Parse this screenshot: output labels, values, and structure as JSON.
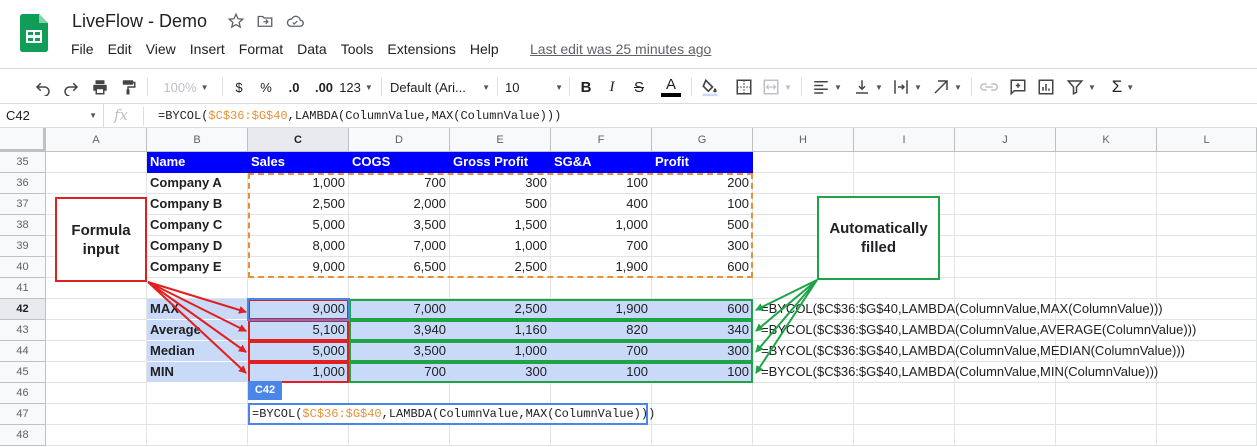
{
  "app": {
    "title": "LiveFlow - Demo",
    "last_edit": "Last edit was 25 minutes ago",
    "menu": [
      "File",
      "Edit",
      "View",
      "Insert",
      "Format",
      "Data",
      "Tools",
      "Extensions",
      "Help"
    ]
  },
  "toolbar": {
    "zoom": "100%",
    "currency": "$",
    "percent": "%",
    "decimal_decrease": ".0",
    "decimal_increase": ".00",
    "number_format": "123",
    "font": "Default (Ari...",
    "font_size": "10",
    "bold": "B",
    "italic": "I",
    "strikethrough": "S",
    "text_color": "A",
    "sum": "Σ"
  },
  "formula_bar": {
    "name_box": "C42",
    "fx": "fx",
    "formula_prefix": "=BYCOL(",
    "formula_ref": "$C$36:$G$40",
    "formula_suffix": ",LAMBDA(ColumnValue,MAX(ColumnValue)))"
  },
  "columns": [
    "A",
    "B",
    "C",
    "D",
    "E",
    "F",
    "G",
    "H",
    "I",
    "J",
    "K",
    "L"
  ],
  "rows": [
    "35",
    "36",
    "37",
    "38",
    "39",
    "40",
    "41",
    "42",
    "43",
    "44",
    "45",
    "46",
    "47",
    "48"
  ],
  "table": {
    "headers": [
      "Name",
      "Sales",
      "COGS",
      "Gross Profit",
      "SG&A",
      "Profit"
    ],
    "data": [
      [
        "Company A",
        "1,000",
        "700",
        "300",
        "100",
        "200"
      ],
      [
        "Company B",
        "2,500",
        "2,000",
        "500",
        "400",
        "100"
      ],
      [
        "Company C",
        "5,000",
        "3,500",
        "1,500",
        "1,000",
        "500"
      ],
      [
        "Company D",
        "8,000",
        "7,000",
        "1,000",
        "700",
        "300"
      ],
      [
        "Company E",
        "9,000",
        "6,500",
        "2,500",
        "1,900",
        "600"
      ]
    ],
    "summary": [
      [
        "MAX",
        "9,000",
        "7,000",
        "2,500",
        "1,900",
        "600"
      ],
      [
        "Average",
        "5,100",
        "3,940",
        "1,160",
        "820",
        "340"
      ],
      [
        "Median",
        "5,000",
        "3,500",
        "1,000",
        "700",
        "300"
      ],
      [
        "MIN",
        "1,000",
        "700",
        "300",
        "100",
        "100"
      ]
    ],
    "formulas": [
      "=BYCOL($C$36:$G$40,LAMBDA(ColumnValue,MAX(ColumnValue)))",
      "=BYCOL($C$36:$G$40,LAMBDA(ColumnValue,AVERAGE(ColumnValue)))",
      "=BYCOL($C$36:$G$40,LAMBDA(ColumnValue,MEDIAN(ColumnValue)))",
      "=BYCOL($C$36:$G$40,LAMBDA(ColumnValue,MIN(ColumnValue)))"
    ]
  },
  "callouts": {
    "left": "Formula input",
    "right": "Automatically filled"
  },
  "cell_tag": "C42",
  "edit_popup": {
    "prefix": "=BYCOL(",
    "ref": "$C$36:$G$40",
    "suffix": ",LAMBDA(ColumnValue,MAX(ColumnValue)))"
  },
  "colors": {
    "header_fill": "#0000ff",
    "summary_fill": "#c9daf8",
    "input_range_border": "#e69138",
    "red_annotation": "#e02020",
    "green_annotation": "#1ea446",
    "selection_blue": "#4a86e8"
  }
}
